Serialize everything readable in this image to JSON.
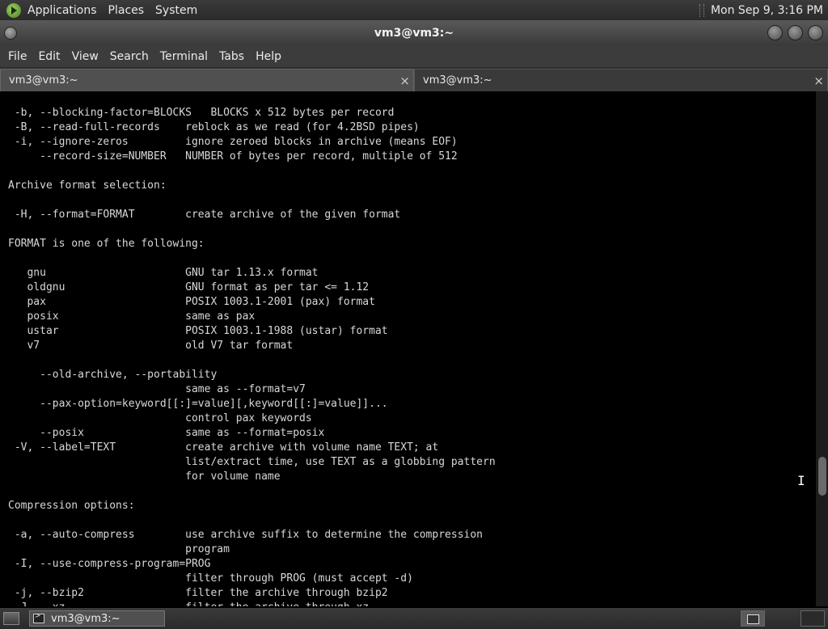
{
  "top_panel": {
    "menus": [
      "Applications",
      "Places",
      "System"
    ],
    "clock": "Mon Sep  9,  3:16 PM"
  },
  "window": {
    "title": "vm3@vm3:~"
  },
  "menubar": {
    "items": [
      "File",
      "Edit",
      "View",
      "Search",
      "Terminal",
      "Tabs",
      "Help"
    ]
  },
  "tabs": [
    {
      "label": "vm3@vm3:~",
      "close": "×"
    },
    {
      "label": "vm3@vm3:~",
      "close": "×"
    }
  ],
  "terminal": {
    "text": "\n -b, --blocking-factor=BLOCKS   BLOCKS x 512 bytes per record\n -B, --read-full-records    reblock as we read (for 4.2BSD pipes)\n -i, --ignore-zeros         ignore zeroed blocks in archive (means EOF)\n     --record-size=NUMBER   NUMBER of bytes per record, multiple of 512\n\nArchive format selection:\n\n -H, --format=FORMAT        create archive of the given format\n\nFORMAT is one of the following:\n\n   gnu                      GNU tar 1.13.x format\n   oldgnu                   GNU format as per tar <= 1.12\n   pax                      POSIX 1003.1-2001 (pax) format\n   posix                    same as pax\n   ustar                    POSIX 1003.1-1988 (ustar) format\n   v7                       old V7 tar format\n\n     --old-archive, --portability\n                            same as --format=v7\n     --pax-option=keyword[[:]=value][,keyword[[:]=value]]...\n                            control pax keywords\n     --posix                same as --format=posix\n -V, --label=TEXT           create archive with volume name TEXT; at\n                            list/extract time, use TEXT as a globbing pattern\n                            for volume name\n\nCompression options:\n\n -a, --auto-compress        use archive suffix to determine the compression\n                            program\n -I, --use-compress-program=PROG\n                            filter through PROG (must accept -d)\n -j, --bzip2                filter the archive through bzip2\n -J, --xz                   filter the archive through xz\n     --lzip                 filter the archive through lzip"
  },
  "taskbar": {
    "window_button": "vm3@vm3:~"
  },
  "icons": {
    "app_logo": "gnome-foot-icon",
    "terminal": "terminal-icon",
    "show_desktop": "show-desktop-icon"
  }
}
